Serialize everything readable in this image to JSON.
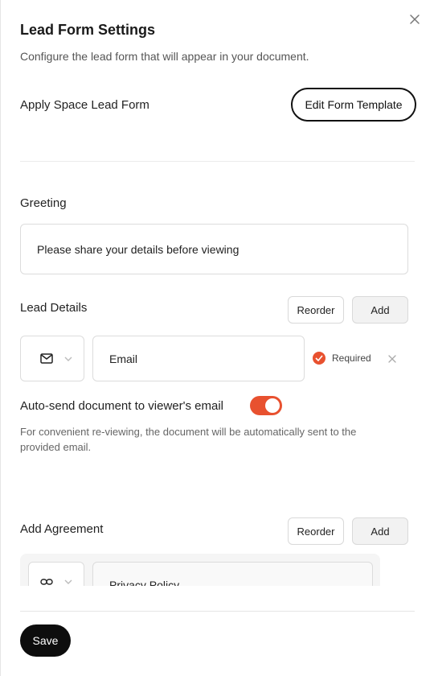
{
  "panel": {
    "title": "Lead Form Settings",
    "subtitle": "Configure the lead form that will appear in your document.",
    "close_icon": "close-icon"
  },
  "space_form": {
    "label": "Apply Space Lead Form",
    "edit_button": "Edit Form Template"
  },
  "greeting": {
    "label": "Greeting",
    "value": "Please share your details before viewing"
  },
  "lead_details": {
    "label": "Lead Details",
    "reorder_button": "Reorder",
    "add_button": "Add",
    "fields": [
      {
        "icon": "mail-icon",
        "value": "Email",
        "required_label": "Required",
        "required": true
      }
    ]
  },
  "auto_send": {
    "label": "Auto-send document to viewer's email",
    "enabled": true,
    "help": "For convenient re-viewing, the document will be automatically sent to the provided email."
  },
  "agreement": {
    "label": "Add Agreement",
    "reorder_button": "Reorder",
    "add_button": "Add",
    "items": [
      {
        "icon": "link-icon",
        "value": "Privacy Policy"
      }
    ]
  },
  "footer": {
    "save_button": "Save"
  },
  "colors": {
    "accent": "#e8512f",
    "primary_button": "#0d0d0d"
  }
}
